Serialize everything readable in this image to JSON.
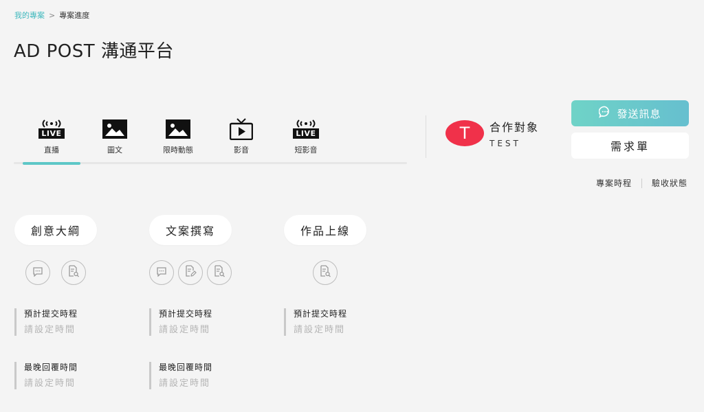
{
  "breadcrumb": {
    "parent": "我的專案",
    "separator": ">",
    "current": "專案進度"
  },
  "page": {
    "title": "AD POST 溝通平台"
  },
  "platform_tabs": [
    {
      "label": "直播",
      "icon": "live-broadcast-icon",
      "badge": "LIVE"
    },
    {
      "label": "圖文",
      "icon": "image-icon"
    },
    {
      "label": "限時動態",
      "icon": "image-icon"
    },
    {
      "label": "影音",
      "icon": "tv-play-icon"
    },
    {
      "label": "短影音",
      "icon": "live-broadcast-icon",
      "badge": "LIVE"
    }
  ],
  "active_tab_index": 0,
  "partner": {
    "avatar_letter": "T",
    "label": "合作對象",
    "name": "TEST",
    "avatar_color": "#f0314a"
  },
  "actions": {
    "message_label": "發送訊息",
    "requirements_label": "需求單"
  },
  "side_links": {
    "schedule": "專案時程",
    "acceptance": "驗收狀態"
  },
  "stages": [
    {
      "title": "創意大綱",
      "icons": [
        "comment-icon",
        "document-search-icon"
      ],
      "fields": [
        {
          "label": "預計提交時程",
          "value": "請設定時間"
        },
        {
          "label": "最晚回覆時間",
          "value": "請設定時間"
        }
      ]
    },
    {
      "title": "文案撰寫",
      "icons": [
        "comment-icon",
        "document-edit-icon",
        "document-search-icon"
      ],
      "fields": [
        {
          "label": "預計提交時程",
          "value": "請設定時間"
        },
        {
          "label": "最晚回覆時間",
          "value": "請設定時間"
        }
      ]
    },
    {
      "title": "作品上線",
      "icons": [
        "document-search-icon"
      ],
      "fields": [
        {
          "label": "預計提交時程",
          "value": "請設定時間"
        }
      ]
    }
  ],
  "colors": {
    "accent": "#5dc7c7",
    "link": "#3fb8bd",
    "placeholder": "#b5b5b5"
  }
}
